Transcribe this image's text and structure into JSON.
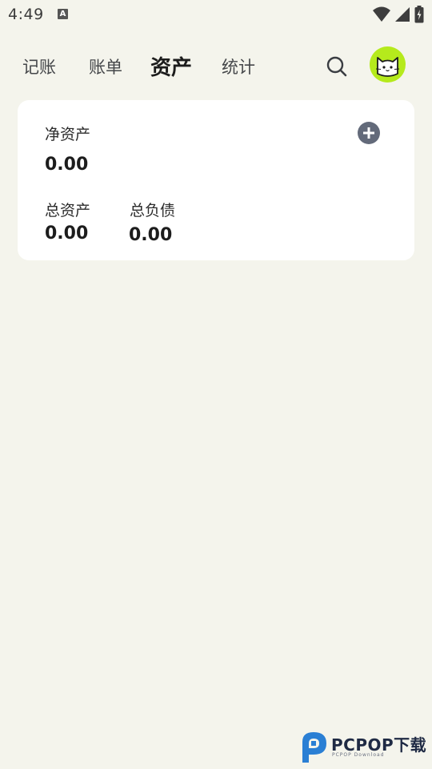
{
  "status_bar": {
    "time": "4:49",
    "notification_icon": "A"
  },
  "nav": {
    "tabs": [
      {
        "label": "记账",
        "active": false
      },
      {
        "label": "账单",
        "active": false
      },
      {
        "label": "资产",
        "active": true
      },
      {
        "label": "统计",
        "active": false
      }
    ],
    "search_icon": "search-icon",
    "avatar": "cat-avatar",
    "avatar_color": "#b5ea1c"
  },
  "assets_card": {
    "net_assets_label": "净资产",
    "net_assets_value": "0.00",
    "total_assets_label": "总资产",
    "total_assets_value": "0.00",
    "total_liabilities_label": "总负债",
    "total_liabilities_value": "0.00",
    "add_icon": "plus-circle-icon"
  },
  "watermark": {
    "text": "PCPOP下载",
    "subtext": "PCPOP Download",
    "color": "#2a7fd4"
  }
}
